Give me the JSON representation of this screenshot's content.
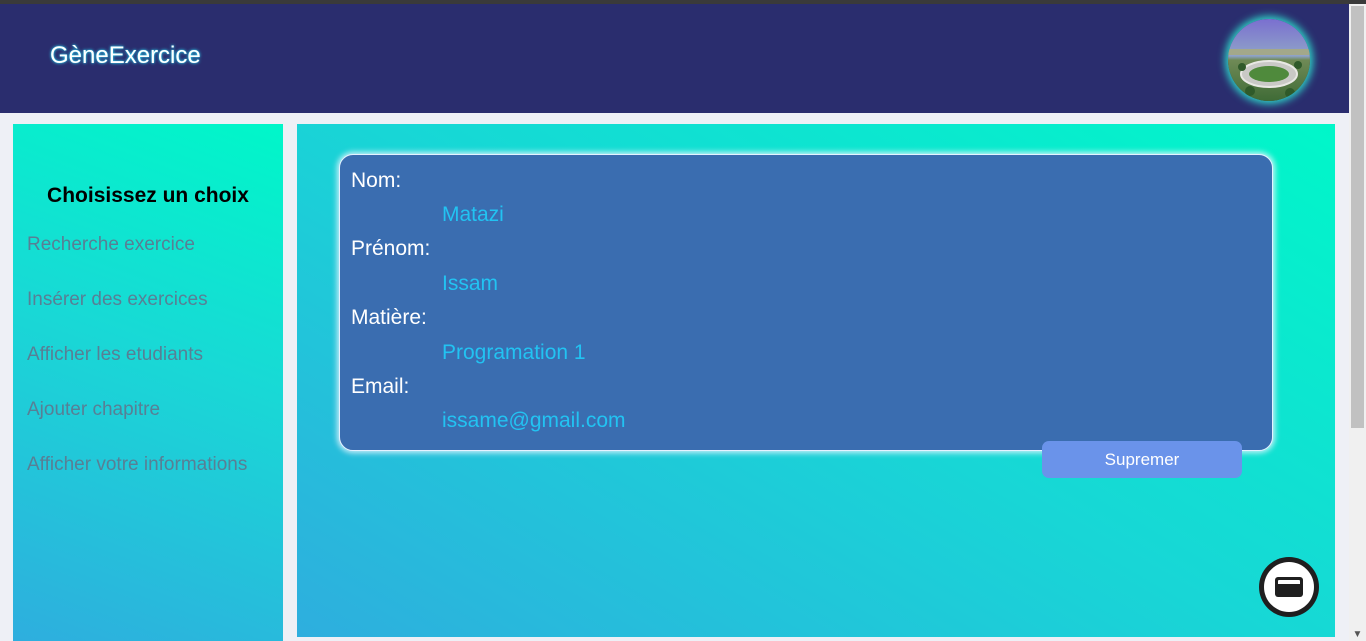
{
  "header": {
    "brand": "GèneExercice",
    "avatar_icon": "avatar-photo-icon"
  },
  "sidebar": {
    "title": "Choisissez un choix",
    "items": [
      {
        "label": "Recherche exercice"
      },
      {
        "label": "Insérer des exercices"
      },
      {
        "label": "Afficher les etudiants"
      },
      {
        "label": "Ajouter chapitre"
      },
      {
        "label": "Afficher votre informations"
      }
    ]
  },
  "profile": {
    "fields": [
      {
        "label": "Nom:",
        "value": "Matazi"
      },
      {
        "label": "Prénom:",
        "value": "Issam"
      },
      {
        "label": "Matière:",
        "value": "Programation 1"
      },
      {
        "label": "Email:",
        "value": "issame@gmail.com"
      }
    ],
    "delete_label": "Supremer"
  },
  "fab": {
    "icon": "mail-icon"
  },
  "colors": {
    "header_bg": "#2a2d6e",
    "card_bg": "#3a6db0",
    "value_text": "#22c3f2",
    "button_bg": "#6a93ea",
    "gradient_start": "#00f7c9",
    "gradient_end": "#2eaede"
  }
}
